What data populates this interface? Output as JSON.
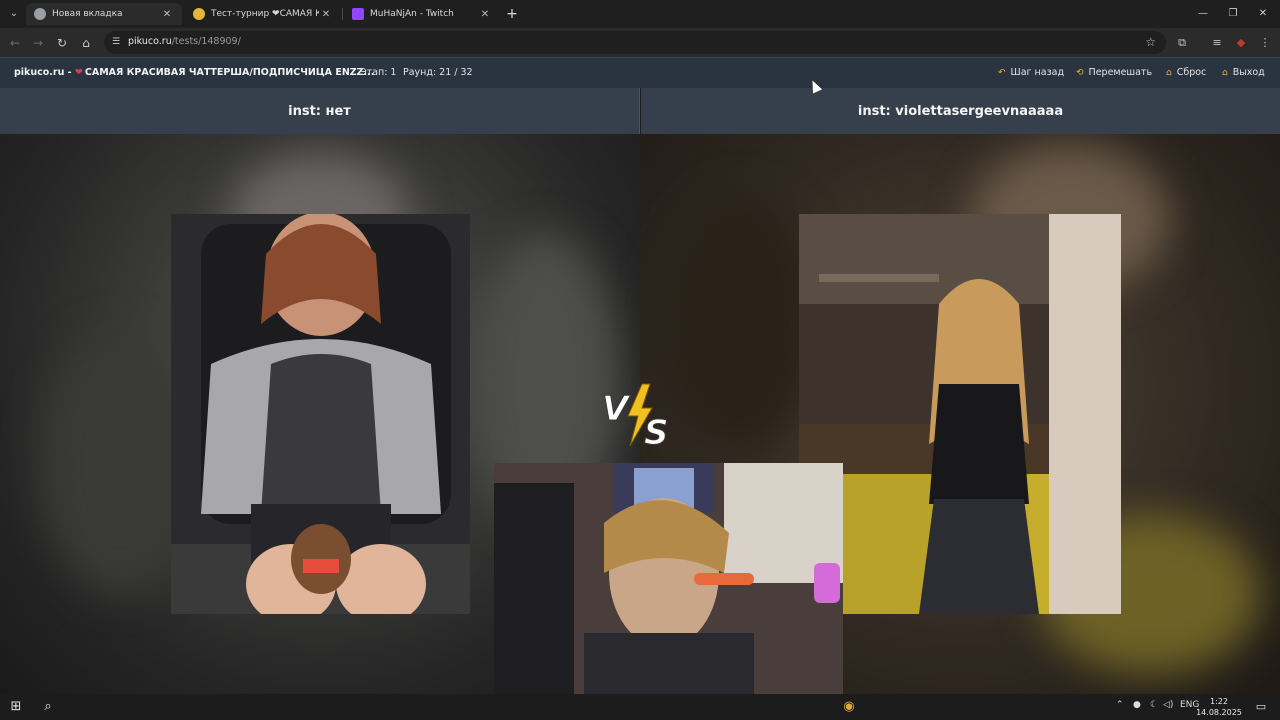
{
  "browser": {
    "tabs": [
      {
        "title": "Новая вкладка",
        "active": true
      },
      {
        "title": "Тест-турнир ❤САМАЯ КРАСИ",
        "active": false
      },
      {
        "title": "MuHaNjAn - Twitch",
        "active": false
      }
    ],
    "url_host": "pikuco.ru",
    "url_path": "/tests/148909/"
  },
  "site": {
    "brand": "pikuco.ru -",
    "test_title": "САМАЯ КРАСИВАЯ ЧАТТЕРША/ПОДПИСЧИЦА ENZZ...",
    "stage": "Этап: 1",
    "round": "Раунд: 21 / 32",
    "actions": {
      "back": "Шаг назад",
      "shuffle": "Перемешать",
      "reset": "Сброс",
      "exit": "Выход"
    }
  },
  "contest": {
    "left_name": "inst: нет",
    "right_name": "inst: violettasergeevnaaaaa",
    "vs_left": "V",
    "vs_right": "S"
  },
  "taskbar": {
    "lang": "ENG",
    "time": "1:22",
    "date": "14.08.2025"
  },
  "colors": {
    "header_bg": "#2a3440",
    "namebar_bg": "#35404c",
    "accent_icon": "#e7b33a",
    "heart": "#e0355a",
    "vs_bolt": "#f2c01e"
  }
}
